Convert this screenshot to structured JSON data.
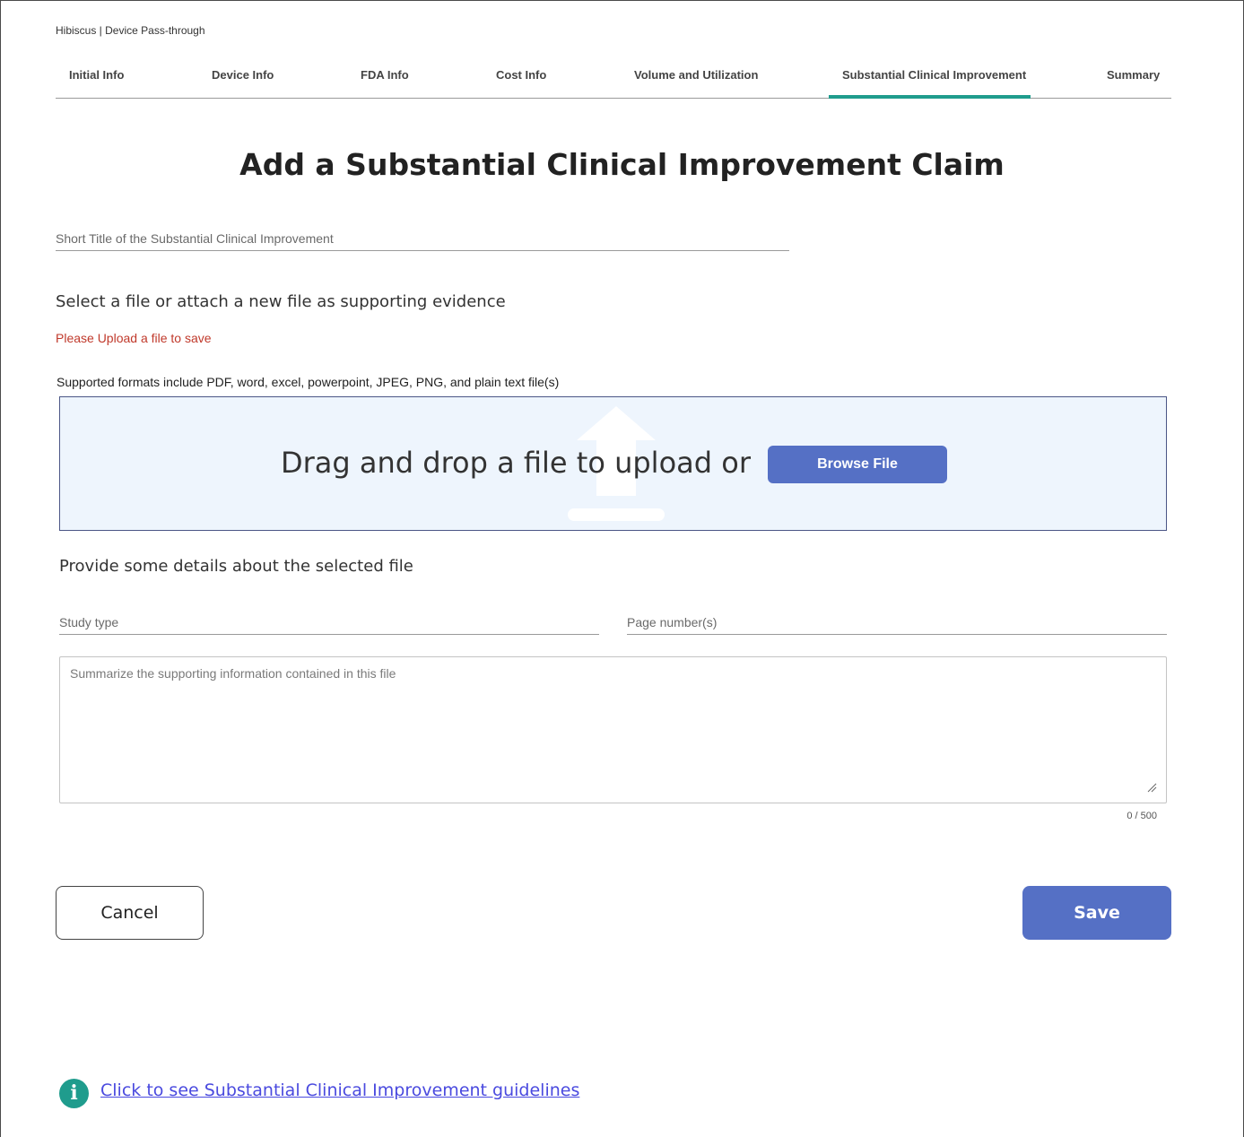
{
  "breadcrumb": "Hibiscus | Device Pass-through",
  "tabs": [
    {
      "label": "Initial Info"
    },
    {
      "label": "Device Info"
    },
    {
      "label": "FDA Info"
    },
    {
      "label": "Cost Info"
    },
    {
      "label": "Volume and Utilization"
    },
    {
      "label": "Substantial Clinical Improvement",
      "active": true
    },
    {
      "label": "Summary"
    }
  ],
  "page_title": "Add a Substantial Clinical Improvement Claim",
  "short_title": {
    "placeholder": "Short Title of the Substantial Clinical Improvement",
    "value": ""
  },
  "select_heading": "Select a file or attach a new file as supporting evidence",
  "error_text": "Please Upload a file to save",
  "formats_text": "Supported formats include PDF, word, excel, powerpoint, JPEG, PNG, and plain text file(s)",
  "dropzone": {
    "text": "Drag and drop a file to upload or",
    "browse_label": "Browse File",
    "icon": "upload-arrow-icon"
  },
  "details_heading": "Provide some details about the selected file",
  "study_type": {
    "placeholder": "Study type",
    "value": ""
  },
  "page_numbers": {
    "placeholder": "Page number(s)",
    "value": ""
  },
  "summary": {
    "placeholder": "Summarize the supporting information contained in this file",
    "counter": "0 / 500"
  },
  "actions": {
    "cancel_label": "Cancel",
    "save_label": "Save"
  },
  "guidelines": {
    "icon": "info-icon",
    "icon_glyph": "i",
    "link_text": "Click to see Substantial Clinical Improvement guidelines"
  },
  "colors": {
    "accent_teal": "#1f9c8d",
    "primary_blue": "#5570c5",
    "error_red": "#c0392b",
    "dropzone_bg": "#eef5fd",
    "link_blue": "#4a4adf"
  }
}
